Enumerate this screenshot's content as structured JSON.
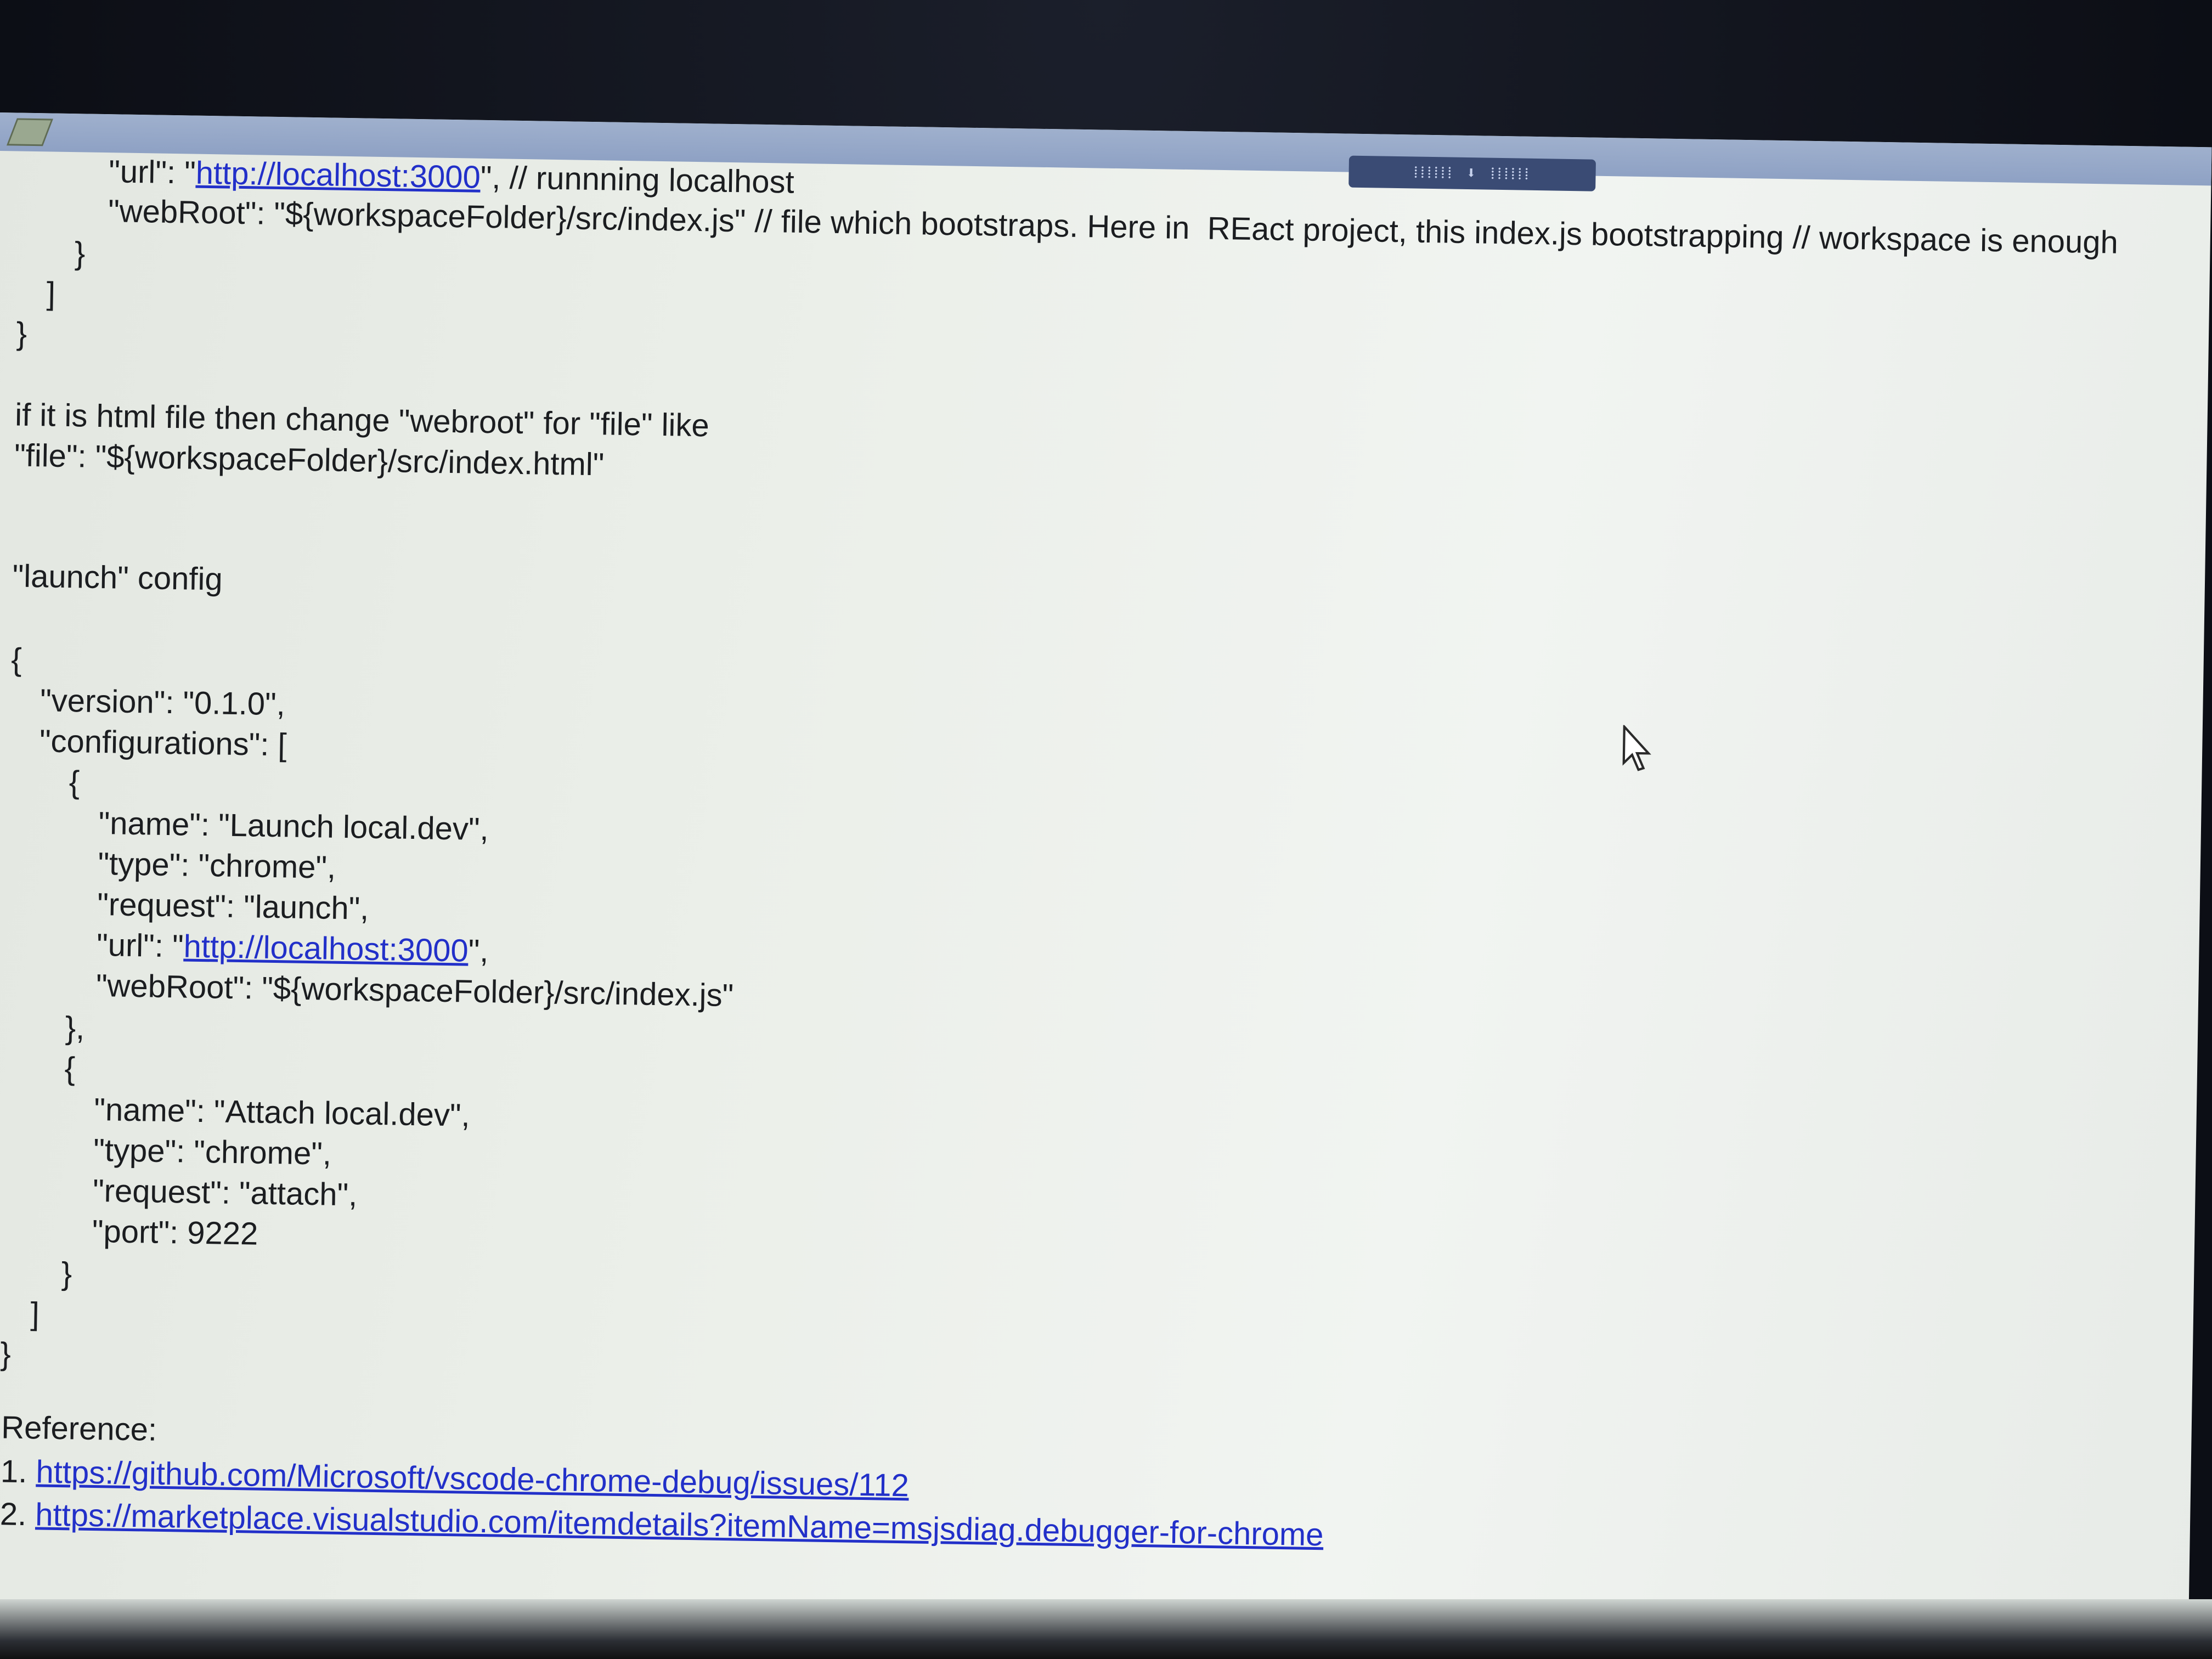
{
  "title_bar": {
    "toolbar_glyphs": "⁞⁞⁞⁞⁞⁞ ⬇ ⁞⁞⁞⁞⁞⁞"
  },
  "document": {
    "lines": [
      "\"url\": \"",
      "\", // runnning localhost",
      "\"webRoot\": \"${workspaceFolder}/src/index.js\" // file which bootstraps. Here in  REact project, this index.js bootstrapping // workspace is enough",
      "}",
      "]",
      "}",
      "if it is html file then change \"webroot\" for \"file\" like",
      "\"file\": \"${workspaceFolder}/src/index.html\"",
      "\"launch\" config",
      "{",
      "\"version\": \"0.1.0\",",
      "\"configurations\": [",
      "{",
      "\"name\": \"Launch local.dev\",",
      "\"type\": \"chrome\",",
      "\"request\": \"launch\",",
      "\"url\": \"",
      "\",",
      "\"webRoot\": \"${workspaceFolder}/src/index.js\"",
      "},",
      "{",
      "\"name\": \"Attach local.dev\",",
      "\"type\": \"chrome\",",
      "\"request\": \"attach\",",
      "\"port\": 9222",
      "}",
      "]",
      "}",
      "Reference:",
      "1. ",
      "2. "
    ],
    "links": {
      "localhost_1": "http://localhost:3000",
      "localhost_2": "http://localhost:3000",
      "ref_1": "https://github.com/Microsoft/vscode-chrome-debug/issues/112",
      "ref_2": "https://marketplace.visualstudio.com/itemdetails?itemName=msjsdiag.debugger-for-chrome"
    }
  },
  "colors": {
    "link": "#2230c9",
    "text": "#1b1d20",
    "title_bar": "#8ea1c4"
  },
  "icons": {
    "document": "document-icon",
    "toolbar": "drag-handle-icon",
    "mouse": "mouse-pointer-icon"
  }
}
